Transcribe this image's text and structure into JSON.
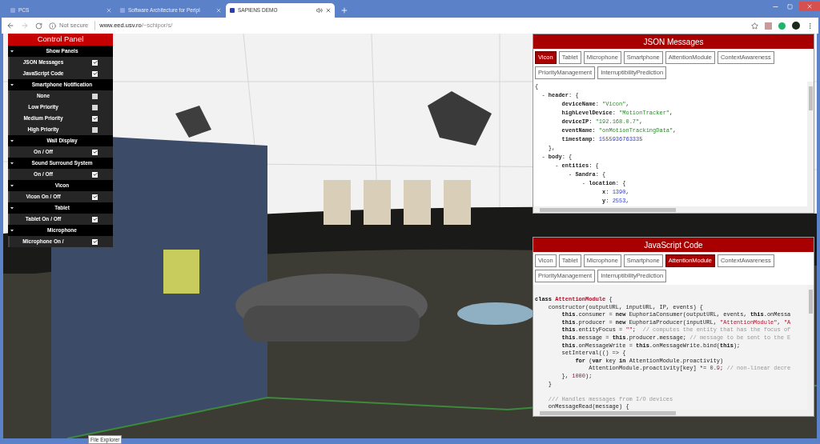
{
  "browser": {
    "tabs": [
      {
        "title": "PCS",
        "selected": false,
        "audio": false
      },
      {
        "title": "Software Architecture for Peripl",
        "selected": false,
        "audio": false
      },
      {
        "title": "SAPIENS DEMO",
        "selected": true,
        "audio": true
      }
    ],
    "address": {
      "security": "Not secure",
      "host": "www.eed.usv.ro",
      "path": "/~schipor/s/"
    }
  },
  "control_panel": {
    "title": "Control Panel",
    "sections": [
      {
        "title": "Show Panels",
        "expanded": true,
        "items": [
          {
            "label": "JSON Messages",
            "checked": true
          },
          {
            "label": "JavaScript Code",
            "checked": true
          }
        ]
      },
      {
        "title": "Smartphone Notification",
        "expanded": true,
        "items": [
          {
            "label": "None",
            "checked": false
          },
          {
            "label": "Low Priority",
            "checked": false
          },
          {
            "label": "Medium Priority",
            "checked": true
          },
          {
            "label": "High Priority",
            "checked": false
          }
        ]
      },
      {
        "title": "Wall Display",
        "expanded": true,
        "items": [
          {
            "label": "On / Off",
            "checked": true
          }
        ]
      },
      {
        "title": "Sound Surround System",
        "expanded": true,
        "items": [
          {
            "label": "On / Off",
            "checked": true
          }
        ]
      },
      {
        "title": "Vicon",
        "expanded": true,
        "items": [
          {
            "label": "Vicon On / Off",
            "checked": true
          }
        ]
      },
      {
        "title": "Tablet",
        "expanded": true,
        "items": [
          {
            "label": "Tablet On / Off",
            "checked": true
          }
        ]
      },
      {
        "title": "Microphone",
        "expanded": true,
        "items": [
          {
            "label": "Microphone On /",
            "checked": true
          }
        ]
      }
    ]
  },
  "json_panel": {
    "title": "JSON Messages",
    "tabs": [
      {
        "label": "Vicon",
        "selected": true
      },
      {
        "label": "Tablet",
        "selected": false
      },
      {
        "label": "Microphone",
        "selected": false
      },
      {
        "label": "Smartphone",
        "selected": false
      },
      {
        "label": "AttentionModule",
        "selected": false
      },
      {
        "label": "ContextAwareness",
        "selected": false
      },
      {
        "label": "PriorityManagement",
        "selected": false
      },
      {
        "label": "InterruptibilityPrediction",
        "selected": false
      }
    ],
    "lines": [
      {
        "kind": "code",
        "segments": [
          {
            "kind": "plain",
            "text": "{"
          }
        ]
      },
      {
        "kind": "code",
        "segments": [
          {
            "kind": "plain",
            "text": "  - "
          },
          {
            "kind": "key",
            "text": "header"
          },
          {
            "kind": "plain",
            "text": ": {"
          }
        ]
      },
      {
        "kind": "code",
        "segments": [
          {
            "kind": "key",
            "text": "        deviceName"
          },
          {
            "kind": "plain",
            "text": ": "
          },
          {
            "kind": "string",
            "text": "\"Vicon\""
          },
          {
            "kind": "plain",
            "text": ","
          }
        ]
      },
      {
        "kind": "code",
        "segments": [
          {
            "kind": "key",
            "text": "        highLevelDevice"
          },
          {
            "kind": "plain",
            "text": ": "
          },
          {
            "kind": "string",
            "text": "\"MotionTracker\""
          },
          {
            "kind": "plain",
            "text": ","
          }
        ]
      },
      {
        "kind": "code",
        "segments": [
          {
            "kind": "key",
            "text": "        deviceIP"
          },
          {
            "kind": "plain",
            "text": ": "
          },
          {
            "kind": "string",
            "text": "\"192.168.0.7\""
          },
          {
            "kind": "plain",
            "text": ","
          }
        ]
      },
      {
        "kind": "code",
        "segments": [
          {
            "kind": "key",
            "text": "        eventName"
          },
          {
            "kind": "plain",
            "text": ": "
          },
          {
            "kind": "string",
            "text": "\"onMotionTrackingData\""
          },
          {
            "kind": "plain",
            "text": ","
          }
        ]
      },
      {
        "kind": "code",
        "segments": [
          {
            "kind": "key",
            "text": "        timestamp"
          },
          {
            "kind": "plain",
            "text": ": "
          },
          {
            "kind": "number",
            "text": "1555936763335"
          }
        ]
      },
      {
        "kind": "code",
        "segments": [
          {
            "kind": "plain",
            "text": "    },"
          }
        ]
      },
      {
        "kind": "code",
        "segments": [
          {
            "kind": "plain",
            "text": "  - "
          },
          {
            "kind": "key",
            "text": "body"
          },
          {
            "kind": "plain",
            "text": ": {"
          }
        ]
      },
      {
        "kind": "code",
        "segments": [
          {
            "kind": "plain",
            "text": "      - "
          },
          {
            "kind": "key",
            "text": "entities"
          },
          {
            "kind": "plain",
            "text": ": {"
          }
        ]
      },
      {
        "kind": "code",
        "segments": [
          {
            "kind": "plain",
            "text": "          - "
          },
          {
            "kind": "key",
            "text": "Sandra"
          },
          {
            "kind": "plain",
            "text": ": {"
          }
        ]
      },
      {
        "kind": "code",
        "segments": [
          {
            "kind": "plain",
            "text": "              - "
          },
          {
            "kind": "key",
            "text": "location"
          },
          {
            "kind": "plain",
            "text": ": {"
          }
        ]
      },
      {
        "kind": "code",
        "segments": [
          {
            "kind": "key",
            "text": "                    x"
          },
          {
            "kind": "plain",
            "text": ": "
          },
          {
            "kind": "number",
            "text": "1390"
          },
          {
            "kind": "plain",
            "text": ","
          }
        ]
      },
      {
        "kind": "code",
        "segments": [
          {
            "kind": "key",
            "text": "                    y"
          },
          {
            "kind": "plain",
            "text": ": "
          },
          {
            "kind": "number",
            "text": "2553"
          },
          {
            "kind": "plain",
            "text": ","
          }
        ]
      }
    ]
  },
  "js_panel": {
    "title": "JavaScript Code",
    "tabs": [
      {
        "label": "Vicon",
        "selected": false
      },
      {
        "label": "Tablet",
        "selected": false
      },
      {
        "label": "Microphone",
        "selected": false
      },
      {
        "label": "Smartphone",
        "selected": false
      },
      {
        "label": "AttentionModule",
        "selected": true
      },
      {
        "label": "ContextAwareness",
        "selected": false
      },
      {
        "label": "PriorityManagement",
        "selected": false
      },
      {
        "label": "InterruptibilityPrediction",
        "selected": false
      }
    ],
    "lines": [
      {
        "kind": "code",
        "segments": [
          {
            "kind": "keyword",
            "text": "class "
          },
          {
            "kind": "classname",
            "text": "AttentionModule"
          },
          {
            "kind": "plain",
            "text": " {"
          }
        ]
      },
      {
        "kind": "code",
        "segments": [
          {
            "kind": "plain",
            "text": "    constructor(outputURL, inputURL, IP, events) {"
          }
        ]
      },
      {
        "kind": "code",
        "segments": [
          {
            "kind": "keyword",
            "text": "        this"
          },
          {
            "kind": "plain",
            "text": ".consumer = "
          },
          {
            "kind": "keyword",
            "text": "new"
          },
          {
            "kind": "plain",
            "text": " EuphoriaConsumer(outputURL, events, "
          },
          {
            "kind": "keyword",
            "text": "this"
          },
          {
            "kind": "plain",
            "text": ".onMessa"
          }
        ]
      },
      {
        "kind": "code",
        "segments": [
          {
            "kind": "keyword",
            "text": "        this"
          },
          {
            "kind": "plain",
            "text": ".producer = "
          },
          {
            "kind": "keyword",
            "text": "new"
          },
          {
            "kind": "plain",
            "text": " EuphoriaProducer(inputURL, "
          },
          {
            "kind": "string",
            "text": "\"AttentionModule\""
          },
          {
            "kind": "plain",
            "text": ", "
          },
          {
            "kind": "string",
            "text": "\"A"
          }
        ]
      },
      {
        "kind": "code",
        "segments": [
          {
            "kind": "keyword",
            "text": "        this"
          },
          {
            "kind": "plain",
            "text": ".entityFocus = "
          },
          {
            "kind": "string",
            "text": "\"\""
          },
          {
            "kind": "plain",
            "text": ";  "
          },
          {
            "kind": "comment",
            "text": "// computes the entity that has the focus of"
          }
        ]
      },
      {
        "kind": "code",
        "segments": [
          {
            "kind": "keyword",
            "text": "        this"
          },
          {
            "kind": "plain",
            "text": ".message = "
          },
          {
            "kind": "keyword",
            "text": "this"
          },
          {
            "kind": "plain",
            "text": ".producer.message; "
          },
          {
            "kind": "comment",
            "text": "// message to be sent to the E"
          }
        ]
      },
      {
        "kind": "code",
        "segments": [
          {
            "kind": "keyword",
            "text": "        this"
          },
          {
            "kind": "plain",
            "text": ".onMessageWrite = "
          },
          {
            "kind": "keyword",
            "text": "this"
          },
          {
            "kind": "plain",
            "text": ".onMessageWrite.bind("
          },
          {
            "kind": "keyword",
            "text": "this"
          },
          {
            "kind": "plain",
            "text": ");"
          }
        ]
      },
      {
        "kind": "code",
        "segments": [
          {
            "kind": "plain",
            "text": "        setInterval(() => {"
          }
        ]
      },
      {
        "kind": "code",
        "segments": [
          {
            "kind": "keyword",
            "text": "            for"
          },
          {
            "kind": "plain",
            "text": " ("
          },
          {
            "kind": "keyword",
            "text": "var"
          },
          {
            "kind": "plain",
            "text": " key "
          },
          {
            "kind": "keyword",
            "text": "in"
          },
          {
            "kind": "plain",
            "text": " AttentionModule.proactivity)"
          }
        ]
      },
      {
        "kind": "code",
        "segments": [
          {
            "kind": "plain",
            "text": "                AttentionModule.proactivity[key] *= "
          },
          {
            "kind": "number",
            "text": "0.9"
          },
          {
            "kind": "plain",
            "text": "; "
          },
          {
            "kind": "comment",
            "text": "// non-linear decre"
          }
        ]
      },
      {
        "kind": "code",
        "segments": [
          {
            "kind": "plain",
            "text": "        }, "
          },
          {
            "kind": "number",
            "text": "1000"
          },
          {
            "kind": "plain",
            "text": ");"
          }
        ]
      },
      {
        "kind": "code",
        "segments": [
          {
            "kind": "plain",
            "text": "    }"
          }
        ]
      },
      {
        "kind": "blank"
      },
      {
        "kind": "code",
        "segments": [
          {
            "kind": "comment",
            "text": "    /// Handles messages from I/O devices"
          }
        ]
      },
      {
        "kind": "code",
        "segments": [
          {
            "kind": "plain",
            "text": "    onMessageRead(message) {"
          }
        ]
      }
    ]
  },
  "tooltip": "File Explorer"
}
